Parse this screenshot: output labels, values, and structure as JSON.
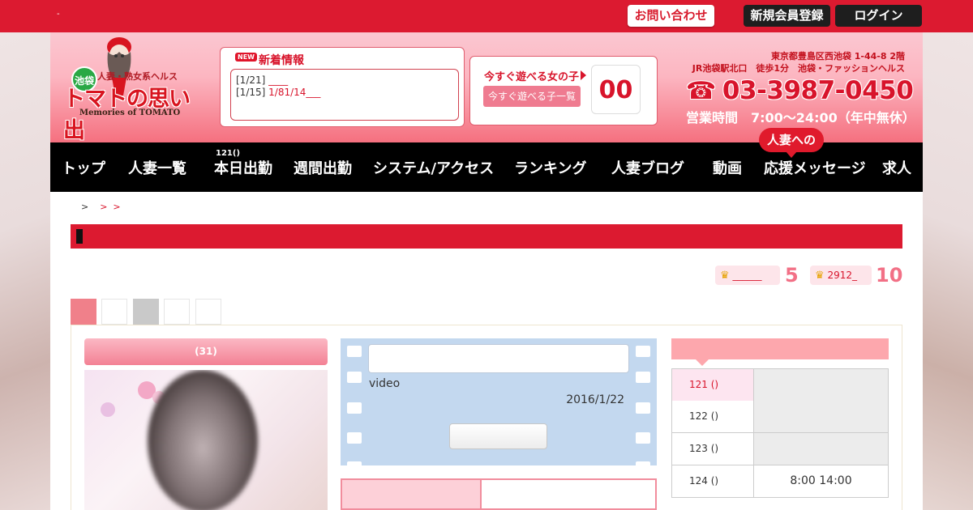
{
  "topbar": {
    "dash": "-",
    "contact_label": "お問い合わせ",
    "register_label": "新規会員登録",
    "login_label": "ログイン"
  },
  "logo": {
    "area_badge": "池袋",
    "subtitle": "人妻・熟女系ヘルス",
    "name": "トマトの思い出",
    "english": "Memories of TOMATO"
  },
  "news": {
    "badge": "NEW",
    "title": "新着情報",
    "items": [
      {
        "date": "[1/21]",
        "link": "____"
      },
      {
        "date": "[1/15]",
        "link": "1/81/14___"
      }
    ]
  },
  "available": {
    "label": "今すぐ遊べる女の子",
    "list_button": "今すぐ遊べる子一覧",
    "count": "00"
  },
  "contact": {
    "address_line1": "東京都豊島区西池袋 1-44-8 2階",
    "address_line2": "JR池袋駅北口　徒歩1分　池袋・ファッションヘルス",
    "phone": "03-3987-0450",
    "hours": "営業時間　7:00～24:00（年中無休）"
  },
  "nav": {
    "today_count": "121()",
    "bubble": "人妻への",
    "items": [
      {
        "label": "トップ"
      },
      {
        "label": "人妻一覧"
      },
      {
        "label": "本日出勤"
      },
      {
        "label": "週間出勤"
      },
      {
        "label": "システム/アクセス"
      },
      {
        "label": "ランキング"
      },
      {
        "label": "人妻ブログ"
      },
      {
        "label": "動画"
      },
      {
        "label": "応援メッセージ"
      },
      {
        "label": "求人"
      }
    ]
  },
  "breadcrumb": {
    "prefix": ">  ",
    "link": "  >  >  "
  },
  "rankings": [
    {
      "crown": "♛",
      "link": "______",
      "value": "5"
    },
    {
      "crown": "♛",
      "link": "2912_",
      "value": "10"
    }
  ],
  "profile": {
    "header": "(31)"
  },
  "video": {
    "label": "video",
    "date": "2016/1/22"
  },
  "schedule": {
    "rows": [
      {
        "day": "121 ()",
        "time": ""
      },
      {
        "day": "122 ()",
        "time": ""
      },
      {
        "day": "123 ()",
        "time": ""
      },
      {
        "day": "124 ()",
        "time": "8:00  14:00"
      }
    ]
  },
  "colors": {
    "brand_red": "#dc1a30",
    "header_pink": "#fcb6c1",
    "nav_black": "#000000",
    "accent_pink": "#f27086"
  }
}
